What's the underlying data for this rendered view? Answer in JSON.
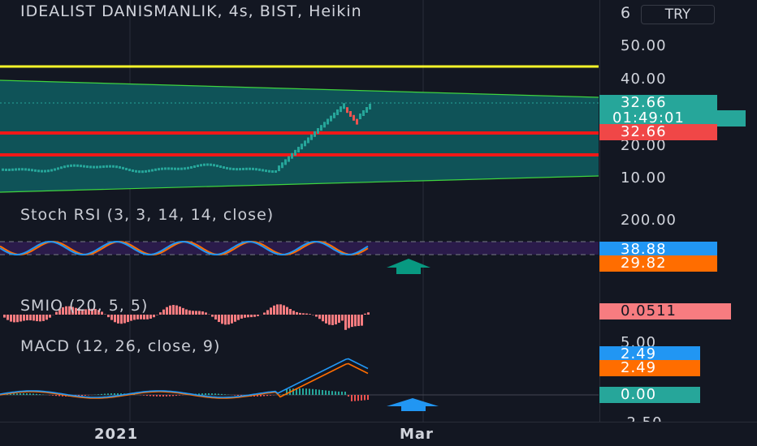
{
  "header": {
    "symbol_title": "IDEALIST DANISMANLIK, 4s, BIST, Heikin",
    "title_overflow": "6",
    "currency": "TRY"
  },
  "price_axis": {
    "ticks": [
      "50.00",
      "40.00",
      "20.00",
      "10.00"
    ],
    "last_price": "32.66",
    "countdown": "01:49:01",
    "red_line_price": "32.66"
  },
  "stoch_rsi": {
    "label": "Stoch RSI (3, 3, 14, 14, close)",
    "axis_tick": "200.00",
    "k_value": "38.88",
    "d_value": "29.82"
  },
  "smio": {
    "label": "SMIO (20, 5, 5)",
    "value": "0.0511"
  },
  "macd": {
    "label": "MACD (12, 26, close, 9)",
    "axis_top": "5.00",
    "macd_value": "2.49",
    "signal_value": "2.49",
    "zero_value": "0.00",
    "axis_bottom": "-2.50"
  },
  "time_axis": {
    "labels": [
      "2021",
      "Mar"
    ]
  },
  "colors": {
    "background": "#131722",
    "channel_fill": "#0f5358",
    "channel_border": "#3fd43f",
    "yellow_line": "#f5f52a",
    "red_line": "#f01818",
    "candle_up": "#26a69a",
    "candle_down": "#ef5350",
    "stoch_band": "#2a1b4a",
    "stoch_k": "#2196f3",
    "stoch_d": "#ff6d00",
    "smio": "#f77c80",
    "macd_arrow": "#2196f3",
    "stoch_arrow": "#089981"
  }
}
